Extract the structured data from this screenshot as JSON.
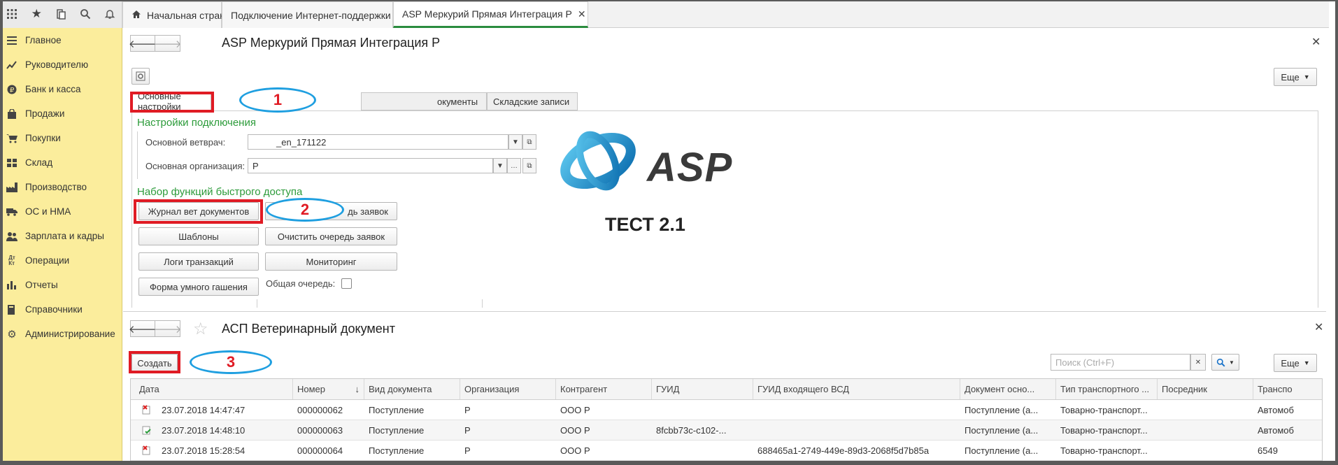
{
  "window_tabs": [
    {
      "label": "Начальная страница",
      "icon": "home-icon"
    },
    {
      "label": "Подключение Интернет-поддержки",
      "closable": true
    },
    {
      "label": "ASP Меркурий Прямая Интеграция Р",
      "closable": true,
      "active": true
    }
  ],
  "sidebar": {
    "items": [
      {
        "label": "Главное",
        "icon": "menu-lines-icon"
      },
      {
        "label": "Руководителю",
        "icon": "chart-line-icon"
      },
      {
        "label": "Банк и касса",
        "icon": "ruble-coin-icon"
      },
      {
        "label": "Продажи",
        "icon": "shopping-bag-icon"
      },
      {
        "label": "Покупки",
        "icon": "cart-icon"
      },
      {
        "label": "Склад",
        "icon": "warehouse-grid-icon"
      },
      {
        "label": "Производство",
        "icon": "factory-icon"
      },
      {
        "label": "ОС и НМА",
        "icon": "truck-icon"
      },
      {
        "label": "Зарплата и кадры",
        "icon": "people-icon"
      },
      {
        "label": "Операции",
        "icon": "debit-credit-icon"
      },
      {
        "label": "Отчеты",
        "icon": "bar-chart-icon"
      },
      {
        "label": "Справочники",
        "icon": "book-icon"
      },
      {
        "label": "Администрирование",
        "icon": "gear-icon"
      }
    ]
  },
  "form": {
    "title": "ASP Меркурий Прямая Интеграция Р",
    "more_label": "Еще",
    "tabs": [
      "Основные настройки",
      "Документы",
      "Складские записи"
    ],
    "tab_partial_visible": "окументы",
    "group_connection": "Настройки подключения",
    "field_vet_label": "Основной ветврач:",
    "field_vet_value": "_en_171122",
    "field_org_label": "Основная организация:",
    "field_org_value": "Р",
    "group_quick": "Набор функций быстрого доступа",
    "btn_journal": "Журнал вет документов",
    "btn_queue_partial": "дь заявок",
    "btn_templates": "Шаблоны",
    "btn_clear_queue": "Очистить очередь заявок",
    "btn_logs": "Логи транзакций",
    "btn_monitoring": "Мониторинг",
    "btn_smart": "Форма умного гашения",
    "chk_common_queue": "Общая очередь:",
    "logo_text": "ASP",
    "test_text": "ТЕСТ 2.1"
  },
  "annotations": [
    "1",
    "2",
    "3"
  ],
  "list": {
    "title": "АСП Ветеринарный документ",
    "create_label": "Создать",
    "search_placeholder": "Поиск (Ctrl+F)",
    "more_label": "Еще",
    "columns": [
      "Дата",
      "Номер",
      "Вид документа",
      "Организация",
      "Контрагент",
      "ГУИД",
      "ГУИД входящего ВСД",
      "Документ осно...",
      "Тип транспортного ...",
      "Посредник",
      "Транспо"
    ],
    "sort_marker": "↓",
    "rows": [
      {
        "status": "error",
        "date": "23.07.2018 14:47:47",
        "number": "000000062",
        "kind": "Поступление",
        "org": "Р",
        "counterparty": "ООО Р",
        "guid": "",
        "guid_in": "",
        "base_doc": "Поступление (а...",
        "transport_type": "Товарно-транспорт...",
        "intermediary": "",
        "transport": "Автомоб"
      },
      {
        "status": "ok",
        "date": "23.07.2018 14:48:10",
        "number": "000000063",
        "kind": "Поступление",
        "org": "Р",
        "counterparty": "ООО Р",
        "guid": "8fcbb73c-c102-...",
        "guid_in": "",
        "base_doc": "Поступление (а...",
        "transport_type": "Товарно-транспорт...",
        "intermediary": "",
        "transport": "Автомоб"
      },
      {
        "status": "error",
        "date": "23.07.2018 15:28:54",
        "number": "000000064",
        "kind": "Поступление",
        "org": "Р",
        "counterparty": "ООО Р",
        "guid": "",
        "guid_in": "688465a1-2749-449e-89d3-2068f5d7b85a",
        "base_doc": "Поступление (а...",
        "transport_type": "Товарно-транспорт...",
        "intermediary": "",
        "transport": "6549"
      }
    ]
  }
}
